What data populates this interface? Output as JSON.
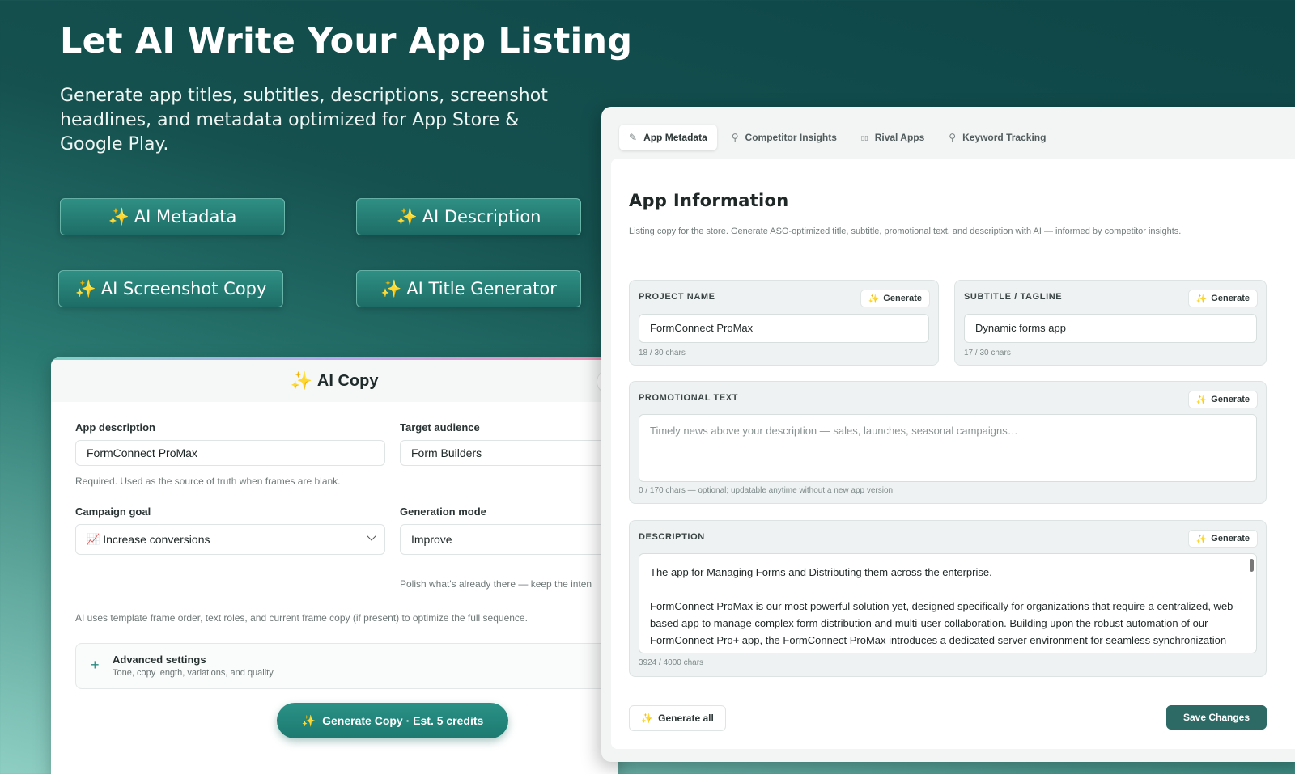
{
  "hero": {
    "title": "Let AI Write Your App Listing",
    "subtitle": "Generate app titles, subtitles, descriptions, screenshot headlines, and metadata optimized for App Store & Google Play."
  },
  "feature_buttons": [
    {
      "label": "AI Metadata"
    },
    {
      "label": "AI Description"
    },
    {
      "label": "AI Screenshot Copy"
    },
    {
      "label": "AI Title Generator"
    }
  ],
  "sparkle_glyph": "✨",
  "ai_copy": {
    "title": "AI Copy",
    "app_description_label": "App description",
    "app_description_value": "FormConnect ProMax",
    "app_description_hint": "Required. Used as the source of truth when frames are blank.",
    "target_audience_label": "Target audience",
    "target_audience_value": "Form Builders",
    "campaign_goal_label": "Campaign goal",
    "campaign_goal_icon": "📈",
    "campaign_goal_value": "Increase conversions",
    "generation_mode_label": "Generation mode",
    "generation_mode_value": "Improve",
    "generation_mode_hint": "Polish what's already there — keep the inten",
    "info_text": "AI uses template frame order, text roles, and current frame copy (if present) to optimize the full sequence.",
    "advanced_title": "Advanced settings",
    "advanced_sub": "Tone, copy length, variations, and quality",
    "generate_button": "Generate Copy · Est. 5 credits",
    "bolt_glyph": "⚡"
  },
  "panel": {
    "tabs": [
      {
        "label": "App Metadata",
        "icon": "✎"
      },
      {
        "label": "Competitor Insights",
        "icon": "⚲"
      },
      {
        "label": "Rival Apps",
        "icon": "▯▯"
      },
      {
        "label": "Keyword Tracking",
        "icon": "⚲"
      }
    ],
    "title": "App Information",
    "description": "Listing copy for the store. Generate ASO-optimized title, subtitle, promotional text, and description with AI — informed by competitor insights.",
    "generate_label": "Generate",
    "project_name": {
      "caption": "PROJECT NAME",
      "value": "FormConnect ProMax",
      "count": "18 / 30 chars"
    },
    "subtitle": {
      "caption": "SUBTITLE / TAGLINE",
      "value": "Dynamic forms app",
      "count": "17 / 30 chars"
    },
    "promo": {
      "caption": "PROMOTIONAL TEXT",
      "placeholder": "Timely news above your description — sales, launches, seasonal campaigns…",
      "count": "0 / 170 chars — optional; updatable anytime without a new app version"
    },
    "description_field": {
      "caption": "DESCRIPTION",
      "line1": "The app for Managing Forms and Distributing them across the enterprise.",
      "line2": "FormConnect ProMax is our most powerful solution yet, designed specifically for organizations that require a centralized, web-based app to manage complex form distribution and multi-user collaboration. Building upon the robust automation of our FormConnect Pro+ app, the FormConnect ProMax introduces a dedicated server environment for seamless synchronization across the entire enterprise.",
      "count": "3924 / 4000 chars"
    },
    "generate_all": "Generate all",
    "save": "Save Changes"
  }
}
